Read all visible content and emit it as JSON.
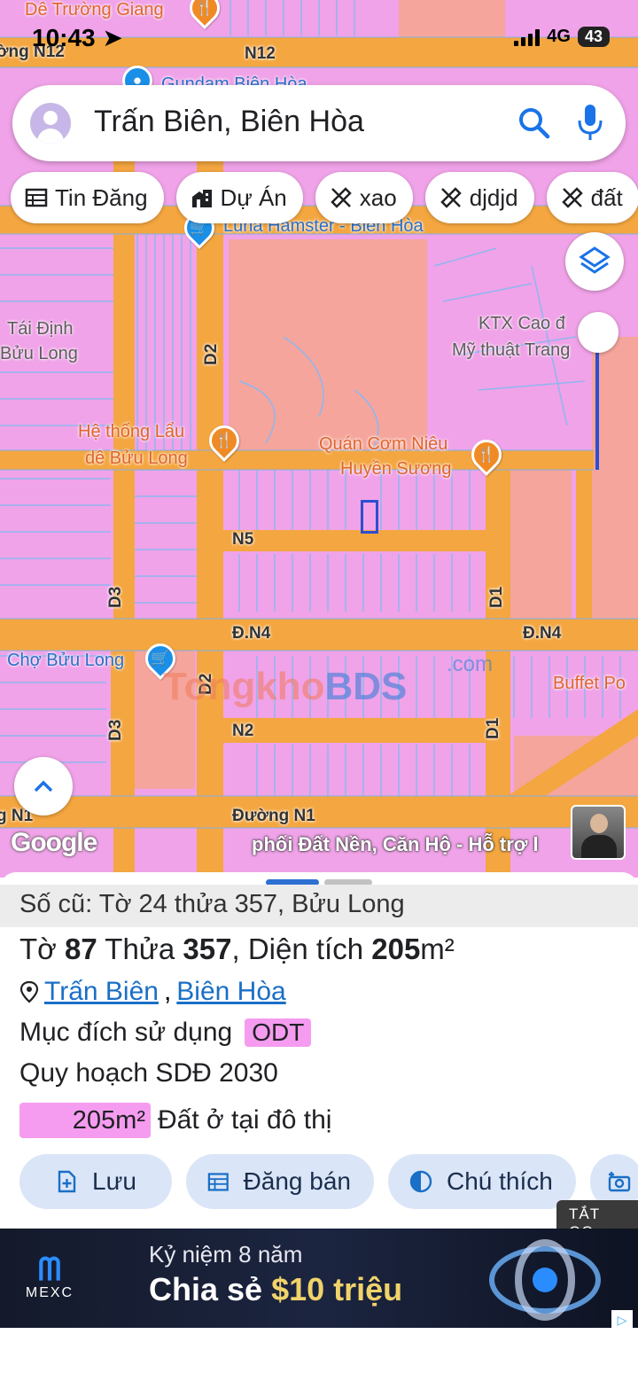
{
  "status_bar": {
    "time": "10:43",
    "network": "4G",
    "battery": "43"
  },
  "search": {
    "query": "Trấn Biên, Biên Hòa"
  },
  "chips": [
    {
      "label": "Tin Đăng",
      "icon": "table-icon"
    },
    {
      "label": "Dự Án",
      "icon": "buildings-icon"
    },
    {
      "label": "xao",
      "icon": "ruler-icon"
    },
    {
      "label": "djdjd",
      "icon": "ruler-icon"
    },
    {
      "label": "đất",
      "icon": "ruler-icon"
    }
  ],
  "map": {
    "labels": {
      "poi_top": "Dê Trường Giang",
      "road_n12_left": "ờng N12",
      "road_n12": "N12",
      "poi_gundam": "Gundam Biên Hòa",
      "poi_luna": "Luna Hamster - Biên Hòa",
      "area_tai_dinh": "Tái Định",
      "area_buu_long": "Bửu Long",
      "ktx_line1": "KTX Cao đ",
      "ktx_line2": "Mỹ thuật Trang",
      "lau_line1": "Hệ thống Lẩu",
      "lau_line2": "dê Bửu Long",
      "com_line1": "Quán Cơm Niêu",
      "com_line2": "Huyền Sương",
      "road_d2_top": "D2",
      "road_n5": "N5",
      "road_d3_top": "D3",
      "road_d1_top": "D1",
      "road_dn4_left": "Đ.N4",
      "road_dn4_right": "Đ.N4",
      "poi_cho": "Chợ Bửu Long",
      "road_d2_bottom": "D2",
      "road_d3_bottom": "D3",
      "road_n2": "N2",
      "road_d1_bottom": "D1",
      "poi_buffet": "Buffet Po",
      "road_n1_left": "g N1",
      "road_n1": "Đường N1"
    },
    "watermark": {
      "part1": "Tongkho",
      "part2": "BDS",
      "suffix": ".com"
    },
    "google_logo": "Google",
    "ad_overlay": "phối Đất Nền, Căn Hộ - Hỗ trợ l"
  },
  "sheet": {
    "old_info": "Số cũ: Tờ 24 thửa 357, Bửu Long",
    "parcel": {
      "to_label": "Tờ",
      "to_value": "87",
      "thua_label": "Thửa",
      "thua_value": "357",
      "area_label": ", Diện tích",
      "area_value": "205",
      "area_unit": "m²"
    },
    "location": {
      "ward": "Trấn Biên",
      "separator": ",",
      "city": "Biên Hòa"
    },
    "purpose_label": "Mục đích sử dụng",
    "purpose_code": "ODT",
    "plan_label": "Quy hoạch SDĐ 2030",
    "area_swatch": "205m²",
    "area_desc": "Đất ở tại đô thị",
    "actions": [
      {
        "label": "Lưu",
        "icon": "add-file-icon"
      },
      {
        "label": "Đăng bán",
        "icon": "calendar-icon"
      },
      {
        "label": "Chú thích",
        "icon": "contrast-icon"
      },
      {
        "label": "",
        "icon": "camera-add-icon"
      }
    ],
    "close_ads": "TẮT QC"
  },
  "ad": {
    "brand": "MEXC",
    "line1": "Kỷ niệm 8 năm",
    "line2_prefix": "Chia sẻ ",
    "line2_money": "$10 triệu"
  },
  "colors": {
    "residential": "#f0a3e8",
    "road": "#f4a640",
    "commercial": "#f5a59c",
    "link": "#1a6fc6",
    "accent": "#2e6fd2"
  }
}
